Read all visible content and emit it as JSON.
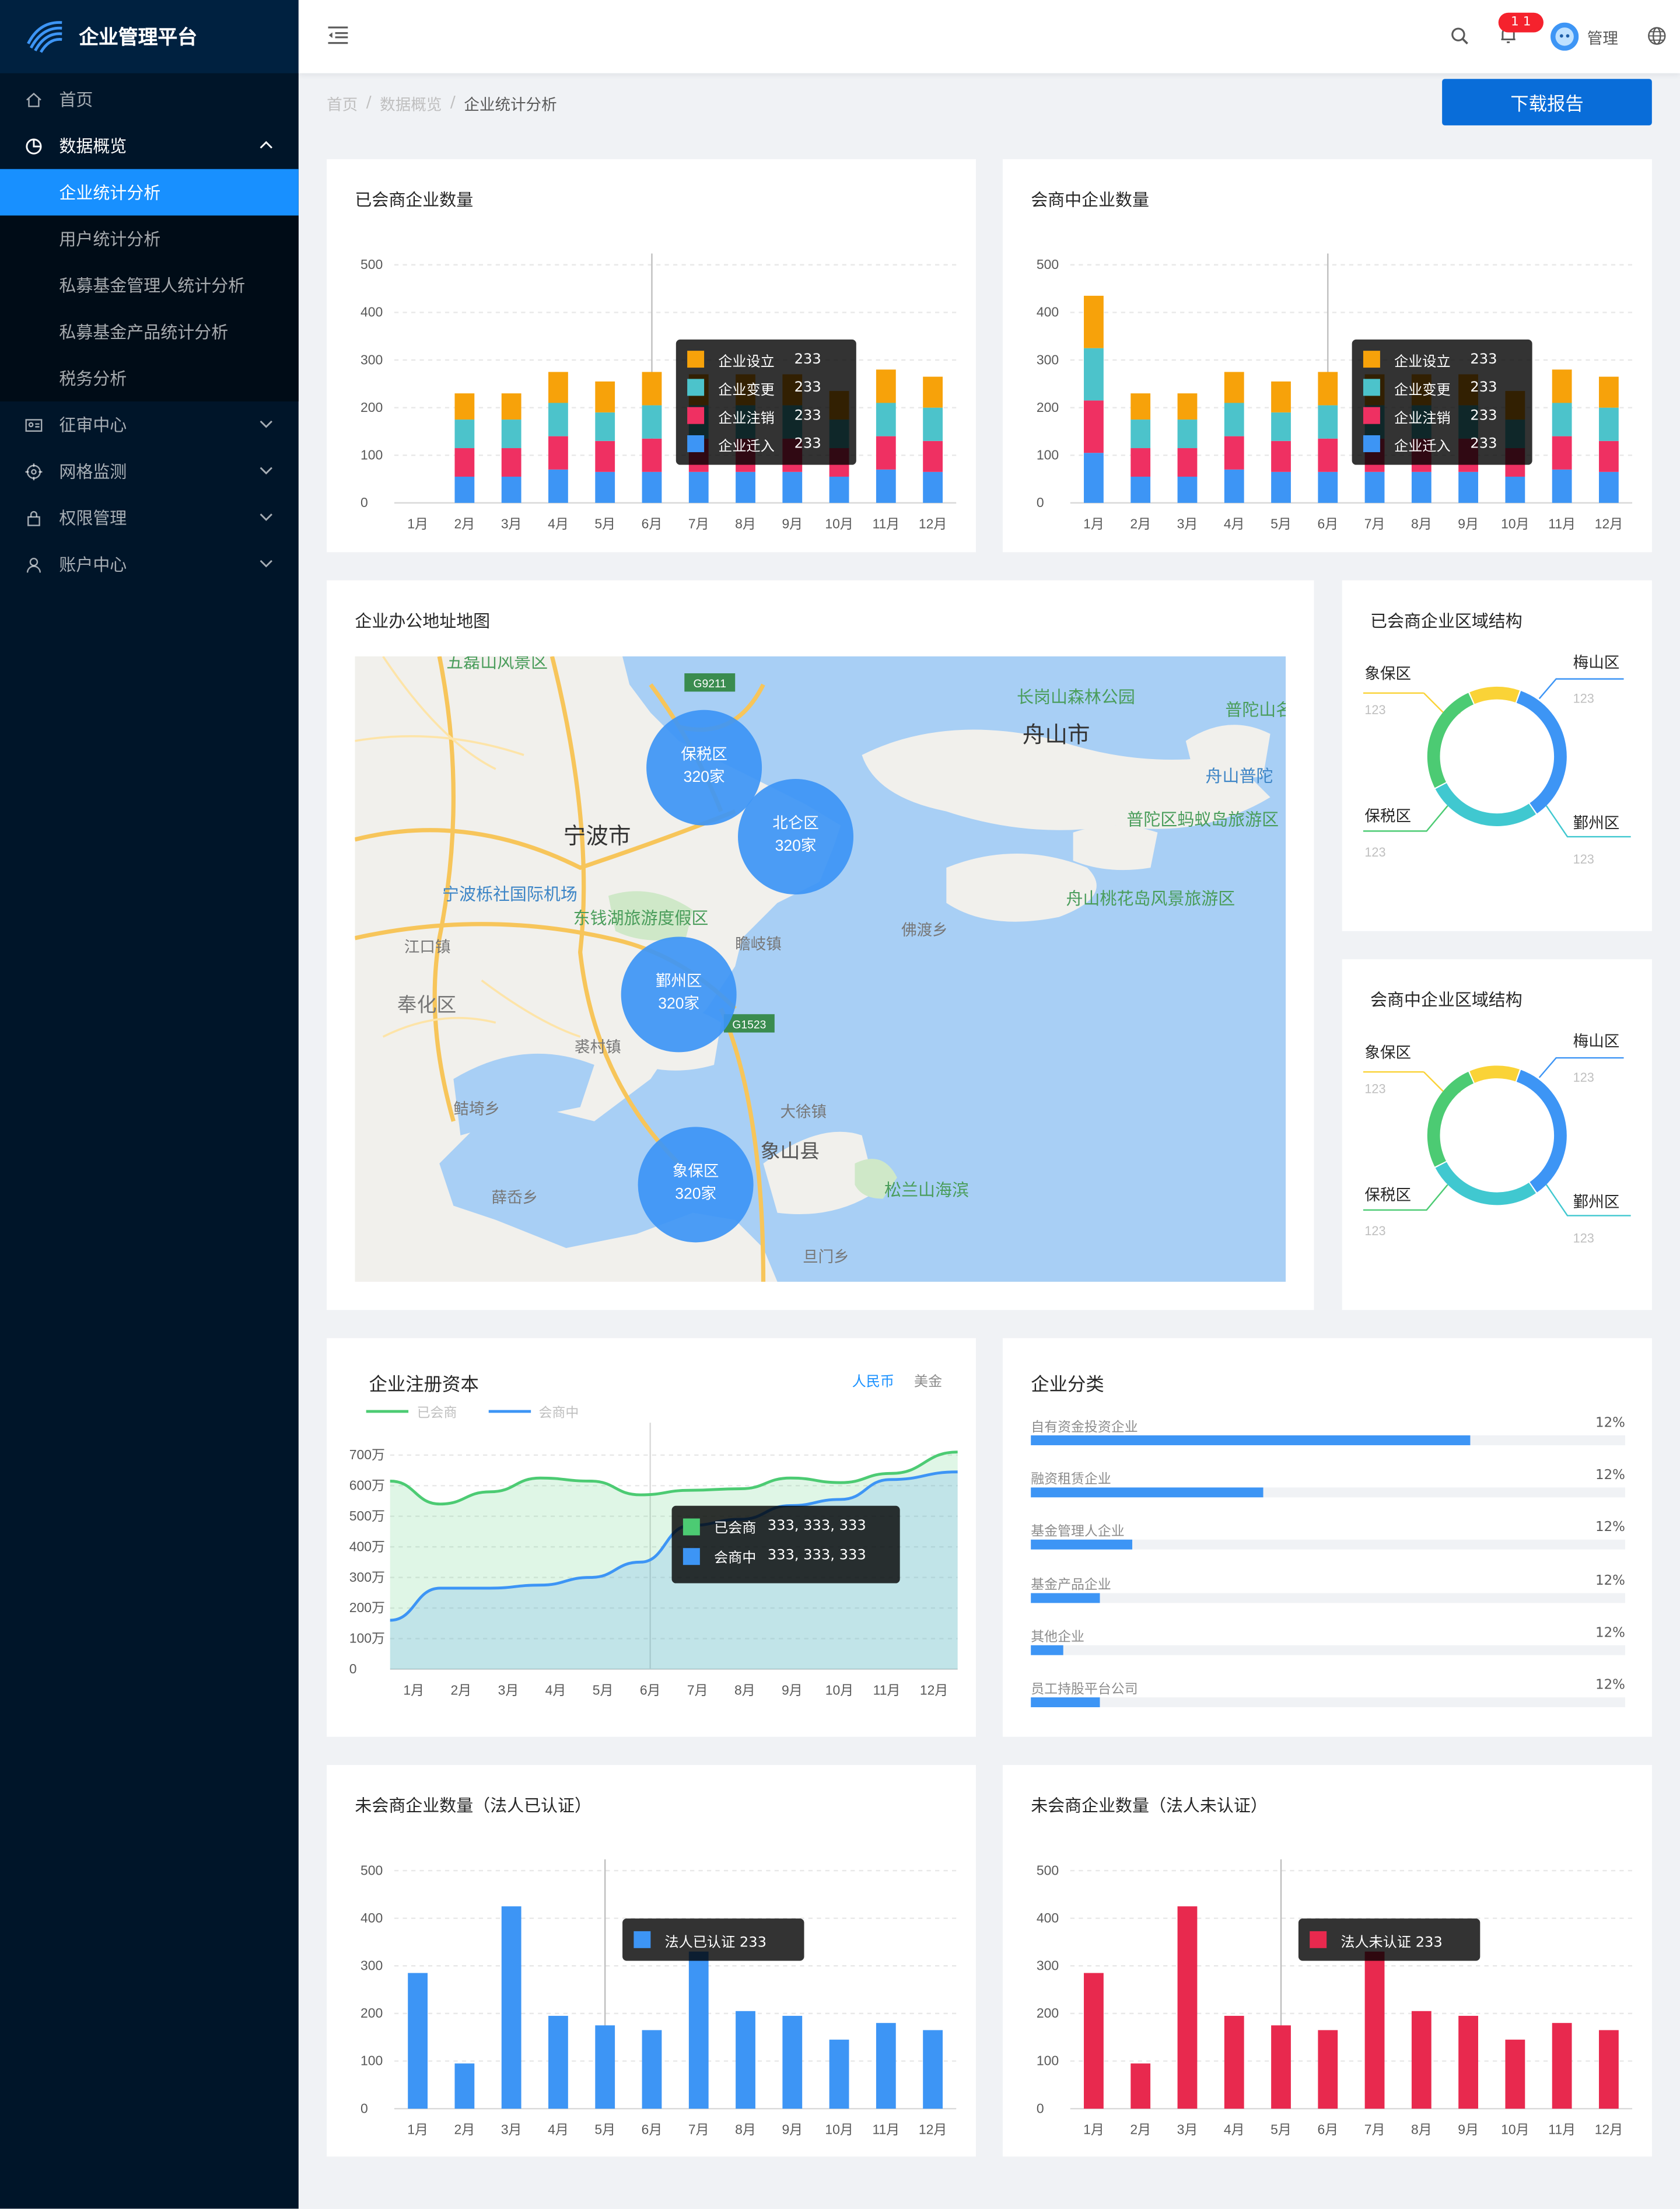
{
  "app": {
    "title": "企业管理平台"
  },
  "sidebar": {
    "items": [
      {
        "label": "首页",
        "icon": "home-icon"
      },
      {
        "label": "数据概览",
        "icon": "pie-chart-icon",
        "open": true,
        "children": [
          "企业统计分析",
          "用户统计分析",
          "私募基金管理人统计分析",
          "私募基金产品统计分析",
          "税务分析"
        ]
      },
      {
        "label": "征审中心",
        "icon": "id-card-icon"
      },
      {
        "label": "网格监测",
        "icon": "target-icon"
      },
      {
        "label": "权限管理",
        "icon": "lock-icon"
      },
      {
        "label": "账户中心",
        "icon": "user-icon"
      }
    ],
    "active_child": "企业统计分析"
  },
  "header": {
    "badge": "1 1",
    "user_name": "管理"
  },
  "breadcrumb": {
    "items": [
      "首页",
      "数据概览",
      "企业统计分析"
    ],
    "sep": "/"
  },
  "actions": {
    "download": "下载报告"
  },
  "months": [
    "1月",
    "2月",
    "3月",
    "4月",
    "5月",
    "6月",
    "7月",
    "8月",
    "9月",
    "10月",
    "11月",
    "12月"
  ],
  "colors": {
    "orange": "#f7a20a",
    "teal": "#4cc3cb",
    "pink": "#ef3062",
    "blue": "#3d95f5",
    "green": "#4ccb73",
    "yellow": "#fad337",
    "red": "#e8294e"
  },
  "cards": {
    "merged": {
      "title": "已会商企业数量",
      "tooltip": [
        {
          "label": "企业设立",
          "value": "233"
        },
        {
          "label": "企业变更",
          "value": "233"
        },
        {
          "label": "企业注销",
          "value": "233"
        },
        {
          "label": "企业迁入",
          "value": "233"
        }
      ]
    },
    "merging": {
      "title": "会商中企业数量",
      "tooltip": [
        {
          "label": "企业设立",
          "value": "233"
        },
        {
          "label": "企业变更",
          "value": "233"
        },
        {
          "label": "企业注销",
          "value": "233"
        },
        {
          "label": "企业迁入",
          "value": "233"
        }
      ]
    },
    "map": {
      "title": "企业办公地址地图",
      "labels": [
        "五磊山风景区",
        "长岗山森林公园",
        "舟山市",
        "普陀山名胜区",
        "舟山普陀",
        "宁波市",
        "普陀区蚂蚁岛旅游区",
        "宁波栎社国际机场",
        "东钱湖旅游度假区",
        "舟山桃花岛风景旅游区",
        "江口镇",
        "瞻岐镇",
        "佛渡乡",
        "奉化区",
        "裘村镇",
        "鲒埼乡",
        "大徐镇",
        "象山县",
        "松兰山海滨",
        "薛岙乡",
        "旦门乡",
        "G9211",
        "G1523"
      ],
      "bubbles": [
        {
          "name": "保税区",
          "value": "320家"
        },
        {
          "name": "北仑区",
          "value": "320家"
        },
        {
          "name": "鄞州区",
          "value": "320家"
        },
        {
          "name": "象保区",
          "value": "320家"
        }
      ]
    },
    "donut1": {
      "title": "已会商企业区域结构",
      "labels": [
        {
          "name": "象保区",
          "value": "123"
        },
        {
          "name": "梅山区",
          "value": "123"
        },
        {
          "name": "保税区",
          "value": "123"
        },
        {
          "name": "鄞州区",
          "value": "123"
        }
      ]
    },
    "donut2": {
      "title": "会商中企业区域结构",
      "labels": [
        {
          "name": "象保区",
          "value": "123"
        },
        {
          "name": "梅山区",
          "value": "123"
        },
        {
          "name": "保税区",
          "value": "123"
        },
        {
          "name": "鄞州区",
          "value": "123"
        }
      ]
    },
    "capital": {
      "title": "企业注册资本",
      "tabs": [
        "人民币",
        "美金"
      ],
      "legend": [
        "已会商",
        "会商中"
      ],
      "tooltip": [
        {
          "label": "已会商",
          "value": "333, 333, 333"
        },
        {
          "label": "会商中",
          "value": "333, 333, 333"
        }
      ]
    },
    "category": {
      "title": "企业分类",
      "rows": [
        {
          "label": "自有资金投资企业",
          "pct": "12%",
          "fill": 0.74
        },
        {
          "label": "融资租赁企业",
          "pct": "12%",
          "fill": 0.39
        },
        {
          "label": "基金管理人企业",
          "pct": "12%",
          "fill": 0.17
        },
        {
          "label": "基金产品企业",
          "pct": "12%",
          "fill": 0.115
        },
        {
          "label": "其他企业",
          "pct": "12%",
          "fill": 0.055
        },
        {
          "label": "员工持股平台公司",
          "pct": "12%",
          "fill": 0.115
        }
      ]
    },
    "unverified_auth": {
      "title": "未会商企业数量（法人已认证）",
      "tooltip": "法人已认证 233"
    },
    "unverified_noauth": {
      "title": "未会商企业数量（法人未认证）",
      "tooltip": "法人未认证 233"
    }
  },
  "chart_data": [
    {
      "type": "bar",
      "stacked": true,
      "title": "已会商企业数量",
      "categories": [
        "1月",
        "2月",
        "3月",
        "4月",
        "5月",
        "6月",
        "7月",
        "8月",
        "9月",
        "10月",
        "11月",
        "12月"
      ],
      "ylim": [
        0,
        500
      ],
      "yticks": [
        0,
        100,
        200,
        300,
        400,
        500
      ],
      "series": [
        {
          "name": "企业迁入",
          "values": [
            0,
            55,
            55,
            70,
            65,
            65,
            65,
            65,
            65,
            55,
            70,
            65
          ]
        },
        {
          "name": "企业注销",
          "values": [
            0,
            60,
            60,
            70,
            65,
            70,
            70,
            70,
            70,
            60,
            70,
            65
          ]
        },
        {
          "name": "企业变更",
          "values": [
            0,
            60,
            60,
            70,
            60,
            70,
            70,
            70,
            70,
            60,
            70,
            70
          ]
        },
        {
          "name": "企业设立",
          "values": [
            0,
            55,
            55,
            65,
            65,
            70,
            65,
            65,
            65,
            60,
            70,
            65
          ]
        }
      ]
    },
    {
      "type": "bar",
      "stacked": true,
      "title": "会商中企业数量",
      "categories": [
        "1月",
        "2月",
        "3月",
        "4月",
        "5月",
        "6月",
        "7月",
        "8月",
        "9月",
        "10月",
        "11月",
        "12月"
      ],
      "ylim": [
        0,
        500
      ],
      "yticks": [
        0,
        100,
        200,
        300,
        400,
        500
      ],
      "series": [
        {
          "name": "企业迁入",
          "values": [
            105,
            55,
            55,
            70,
            65,
            65,
            65,
            65,
            65,
            55,
            70,
            65
          ]
        },
        {
          "name": "企业注销",
          "values": [
            110,
            60,
            60,
            70,
            65,
            70,
            70,
            70,
            70,
            60,
            70,
            65
          ]
        },
        {
          "name": "企业变更",
          "values": [
            110,
            60,
            60,
            70,
            60,
            70,
            70,
            70,
            70,
            60,
            70,
            70
          ]
        },
        {
          "name": "企业设立",
          "values": [
            110,
            55,
            55,
            65,
            65,
            70,
            65,
            65,
            65,
            60,
            70,
            65
          ]
        }
      ]
    },
    {
      "type": "pie",
      "donut": true,
      "title": "已会商企业区域结构",
      "series": [
        {
          "name": "梅山区",
          "value": 35
        },
        {
          "name": "鄞州区",
          "value": 27
        },
        {
          "name": "保税区",
          "value": 26
        },
        {
          "name": "象保区",
          "value": 12
        }
      ]
    },
    {
      "type": "pie",
      "donut": true,
      "title": "会商中企业区域结构",
      "series": [
        {
          "name": "梅山区",
          "value": 35
        },
        {
          "name": "鄞州区",
          "value": 27
        },
        {
          "name": "保税区",
          "value": 26
        },
        {
          "name": "象保区",
          "value": 12
        }
      ]
    },
    {
      "type": "area",
      "title": "企业注册资本",
      "categories": [
        "1月",
        "2月",
        "3月",
        "4月",
        "5月",
        "6月",
        "7月",
        "8月",
        "9月",
        "10月",
        "11月",
        "12月"
      ],
      "ylim": [
        0,
        700
      ],
      "yticks": [
        {
          "v": 0,
          "label": "0"
        },
        {
          "v": 100,
          "label": "100万"
        },
        {
          "v": 200,
          "label": "200万"
        },
        {
          "v": 300,
          "label": "300万"
        },
        {
          "v": 400,
          "label": "400万"
        },
        {
          "v": 500,
          "label": "500万"
        },
        {
          "v": 600,
          "label": "600万"
        },
        {
          "v": 700,
          "label": "700万"
        }
      ],
      "series": [
        {
          "name": "已会商",
          "values": [
            615,
            540,
            580,
            625,
            615,
            570,
            585,
            590,
            625,
            610,
            640,
            710
          ]
        },
        {
          "name": "会商中",
          "values": [
            160,
            265,
            265,
            275,
            300,
            350,
            470,
            490,
            535,
            555,
            620,
            645
          ]
        }
      ]
    },
    {
      "type": "bar",
      "title": "未会商企业数量（法人已认证）",
      "categories": [
        "1月",
        "2月",
        "3月",
        "4月",
        "5月",
        "6月",
        "7月",
        "8月",
        "9月",
        "10月",
        "11月",
        "12月"
      ],
      "ylim": [
        0,
        500
      ],
      "yticks": [
        0,
        100,
        200,
        300,
        400,
        500
      ],
      "series": [
        {
          "name": "法人已认证",
          "values": [
            285,
            95,
            425,
            195,
            175,
            165,
            330,
            205,
            195,
            145,
            180,
            165
          ]
        }
      ]
    },
    {
      "type": "bar",
      "title": "未会商企业数量（法人未认证）",
      "categories": [
        "1月",
        "2月",
        "3月",
        "4月",
        "5月",
        "6月",
        "7月",
        "8月",
        "9月",
        "10月",
        "11月",
        "12月"
      ],
      "ylim": [
        0,
        500
      ],
      "yticks": [
        0,
        100,
        200,
        300,
        400,
        500
      ],
      "series": [
        {
          "name": "法人未认证",
          "values": [
            285,
            95,
            425,
            195,
            175,
            165,
            330,
            205,
            195,
            145,
            180,
            165
          ]
        }
      ]
    }
  ]
}
